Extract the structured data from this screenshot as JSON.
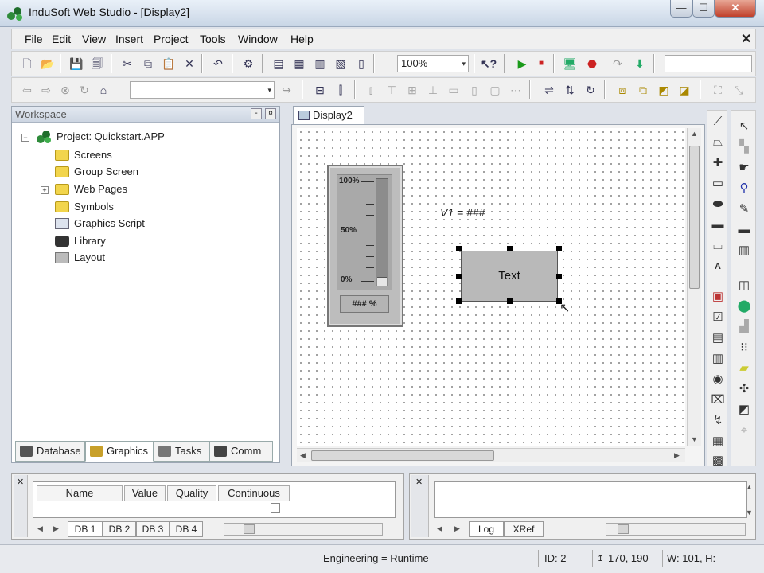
{
  "window": {
    "title": "InduSoft Web Studio - [Display2]",
    "controls": {
      "minimize": "—",
      "maximize": "☐",
      "close": "✕"
    }
  },
  "menu": [
    "File",
    "Edit",
    "View",
    "Insert",
    "Project",
    "Tools",
    "Window",
    "Help"
  ],
  "toolbar": {
    "zoom": "100%",
    "zoom_arrow": "▾",
    "object_combo": "",
    "object_combo_arrow": "▾"
  },
  "workspace": {
    "title": "Workspace",
    "tree": {
      "root": "Project: Quickstart.APP",
      "items": [
        "Screens",
        "Group Screen",
        "Web Pages",
        "Symbols",
        "Graphics Script",
        "Library",
        "Layout"
      ]
    },
    "tabs": [
      "Database",
      "Graphics",
      "Tasks",
      "Comm"
    ]
  },
  "document": {
    "tab": "Display2",
    "bargraph": {
      "scale_top": "100%",
      "scale_mid": "50%",
      "scale_bottom": "0%",
      "value_text": "### %",
      "fill_percent": 8
    },
    "var_label": "V1 = ###",
    "text_object": "Text"
  },
  "database_panel": {
    "columns": [
      "Name",
      "Value",
      "Quality",
      "Continuous"
    ],
    "tabs": [
      "DB 1",
      "DB 2",
      "DB 3",
      "DB 4"
    ]
  },
  "output_panel": {
    "tabs": [
      "Log",
      "XRef"
    ]
  },
  "status": {
    "mode": "Engineering = Runtime",
    "id": "ID: 2",
    "position": "170, 190",
    "size": "W: 101, H:"
  },
  "colors": {
    "accent": "#2f5ea8",
    "canvas_grid": "#9a9a9a",
    "folder": "#f2d54c"
  }
}
